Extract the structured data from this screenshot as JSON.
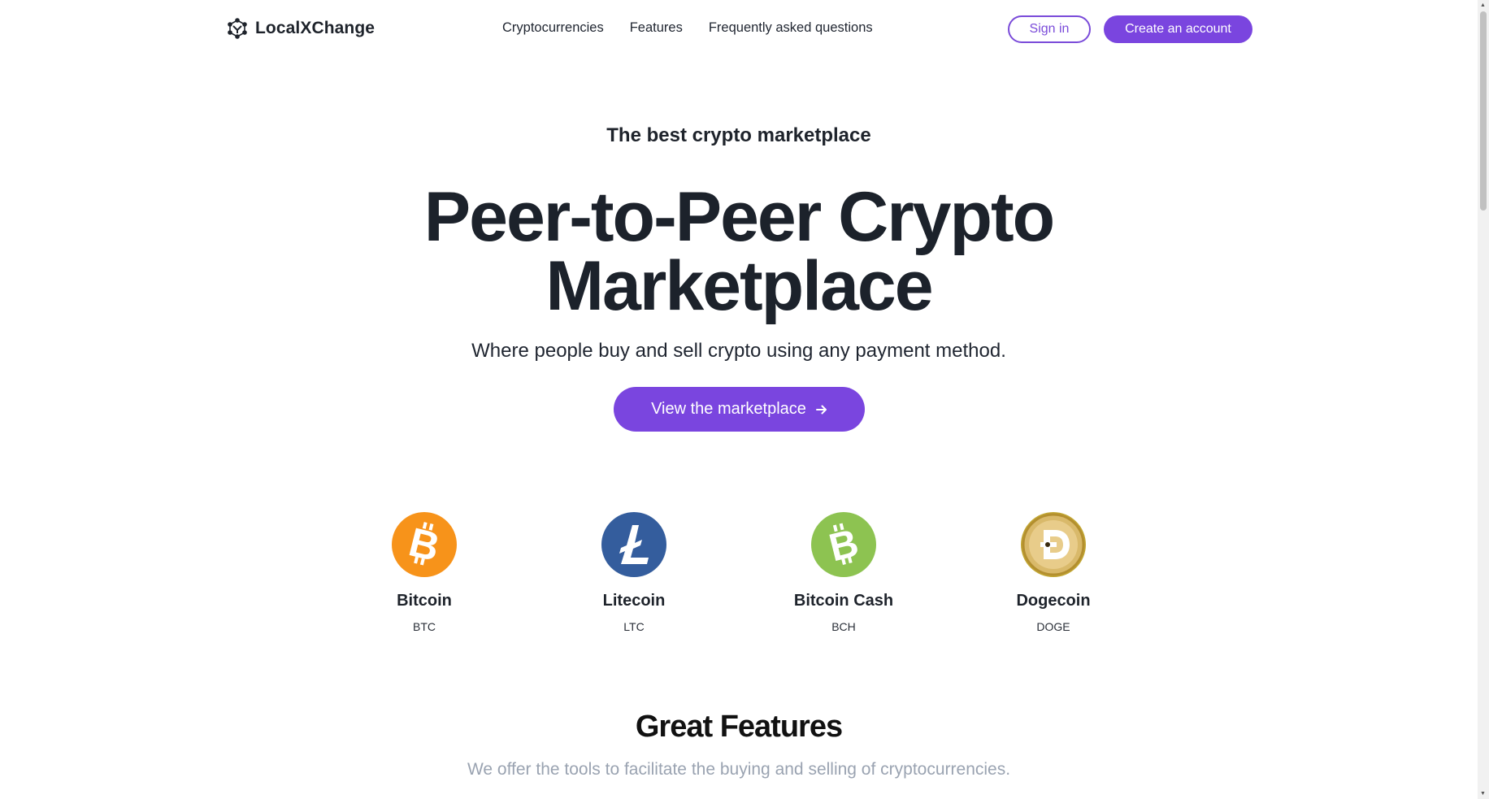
{
  "header": {
    "brand": "LocalXChange",
    "nav": [
      {
        "label": "Cryptocurrencies"
      },
      {
        "label": "Features"
      },
      {
        "label": "Frequently asked questions"
      }
    ],
    "signin_label": "Sign in",
    "create_label": "Create an account"
  },
  "hero": {
    "eyebrow": "The best crypto marketplace",
    "title_line1": "Peer-to-Peer Crypto",
    "title_line2": "Marketplace",
    "subtitle": "Where people buy and sell crypto using any payment method.",
    "cta_label": "View the marketplace",
    "cta_icon": "arrow-right-icon"
  },
  "coins": [
    {
      "name": "Bitcoin",
      "ticker": "BTC",
      "color": "#f7931a",
      "icon": "bitcoin-icon"
    },
    {
      "name": "Litecoin",
      "ticker": "LTC",
      "color": "#345d9d",
      "icon": "litecoin-icon"
    },
    {
      "name": "Bitcoin Cash",
      "ticker": "BCH",
      "color": "#8dc351",
      "icon": "bitcoin-cash-icon"
    },
    {
      "name": "Dogecoin",
      "ticker": "DOGE",
      "color": "#c2a633",
      "icon": "dogecoin-icon"
    }
  ],
  "features": {
    "title": "Great Features",
    "subtitle": "We offer the tools to facilitate the buying and selling of cryptocurrencies."
  },
  "colors": {
    "accent": "#7a45df",
    "text": "#1f2530",
    "muted": "#9aa3b1"
  }
}
